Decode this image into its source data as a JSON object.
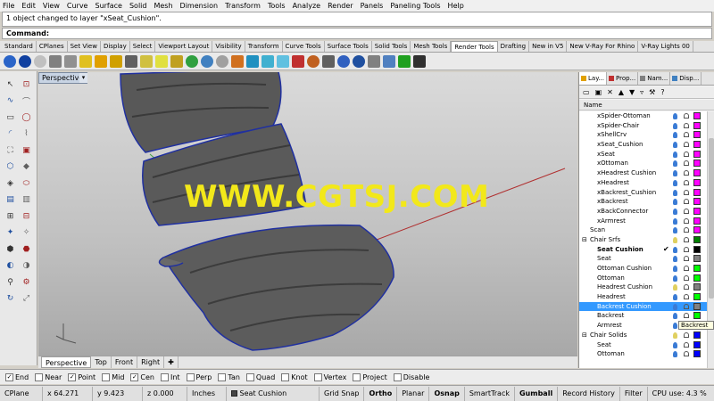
{
  "menu": [
    "File",
    "Edit",
    "View",
    "Curve",
    "Surface",
    "Solid",
    "Mesh",
    "Dimension",
    "Transform",
    "Tools",
    "Analyze",
    "Render",
    "Panels",
    "Paneling Tools",
    "Help"
  ],
  "history_text": "1 object changed to layer \"xSeat_Cushion\".",
  "command_label": "Command:",
  "toolbar_tabs": [
    "Standard",
    "CPlanes",
    "Set View",
    "Display",
    "Select",
    "Viewport Layout",
    "Visibility",
    "Transform",
    "Curve Tools",
    "Surface Tools",
    "Solid Tools",
    "Mesh Tools",
    "Render Tools",
    "Drafting",
    "New in V5",
    "New V-Ray For Rhino",
    "V-Ray Lights 00"
  ],
  "active_toolbar_tab": "Render Tools",
  "viewport": {
    "title": "Perspective",
    "watermark": "WWW.CGTSJ.COM"
  },
  "viewport_tabs": [
    "Perspective",
    "Top",
    "Front",
    "Right"
  ],
  "active_viewport_tab": "Perspective",
  "osnaps": [
    {
      "label": "End",
      "checked": true
    },
    {
      "label": "Near",
      "checked": false
    },
    {
      "label": "Point",
      "checked": true
    },
    {
      "label": "Mid",
      "checked": false
    },
    {
      "label": "Cen",
      "checked": true
    },
    {
      "label": "Int",
      "checked": false
    },
    {
      "label": "Perp",
      "checked": false
    },
    {
      "label": "Tan",
      "checked": false
    },
    {
      "label": "Quad",
      "checked": false
    },
    {
      "label": "Knot",
      "checked": false
    },
    {
      "label": "Vertex",
      "checked": false
    },
    {
      "label": "Project",
      "checked": false
    },
    {
      "label": "Disable",
      "checked": false
    }
  ],
  "status": {
    "cplane": "CPlane",
    "x": "x 64.271",
    "y": "y 9.423",
    "z": "z 0.000",
    "units": "Inches",
    "layer": "Seat Cushion",
    "grid_snap": "Grid Snap",
    "ortho": "Ortho",
    "planar": "Planar",
    "osnap": "Osnap",
    "smarttrack": "SmartTrack",
    "gumball": "Gumball",
    "record_history": "Record History",
    "filter": "Filter",
    "cpu": "CPU use: 4.3 %"
  },
  "panel": {
    "tabs": [
      "Lay...",
      "Prop...",
      "Nam...",
      "Disp..."
    ],
    "active_tab": "Lay...",
    "column_header": "Name",
    "layers": [
      {
        "name": "xSpider-Ottoman",
        "indent": 1,
        "color": "#ff00ff"
      },
      {
        "name": "xSpider-Chair",
        "indent": 1,
        "color": "#ff00ff"
      },
      {
        "name": "xShellCrv",
        "indent": 1,
        "color": "#ff00ff"
      },
      {
        "name": "xSeat_Cushion",
        "indent": 1,
        "color": "#ff00ff"
      },
      {
        "name": "xSeat",
        "indent": 1,
        "color": "#ff00ff"
      },
      {
        "name": "xOttoman",
        "indent": 1,
        "color": "#ff00ff"
      },
      {
        "name": "xHeadrest Cushion",
        "indent": 1,
        "color": "#ff00ff"
      },
      {
        "name": "xHeadrest",
        "indent": 1,
        "color": "#ff00ff"
      },
      {
        "name": "xBackrest_Cushion",
        "indent": 1,
        "color": "#ff00ff"
      },
      {
        "name": "xBackrest",
        "indent": 1,
        "color": "#ff00ff"
      },
      {
        "name": "xBackConnector",
        "indent": 1,
        "color": "#ff00ff"
      },
      {
        "name": "xArmrest",
        "indent": 1,
        "color": "#ff00ff"
      },
      {
        "name": "Scan",
        "indent": 0,
        "color": "#ff00ff"
      },
      {
        "name": "Chair Srfs",
        "indent": -1,
        "color": "#008000",
        "group": true
      },
      {
        "name": "Seat Cushion",
        "indent": 1,
        "color": "#000000",
        "current": true
      },
      {
        "name": "Seat",
        "indent": 1,
        "color": "#808080"
      },
      {
        "name": "Ottoman Cushion",
        "indent": 1,
        "color": "#00ff00"
      },
      {
        "name": "Ottoman",
        "indent": 1,
        "color": "#00ff00"
      },
      {
        "name": "Headrest Cushion",
        "indent": 1,
        "color": "#808080"
      },
      {
        "name": "Headrest",
        "indent": 1,
        "color": "#00ff00"
      },
      {
        "name": "Backrest Cushion",
        "indent": 1,
        "color": "#808080",
        "selected": true
      },
      {
        "name": "Backrest",
        "indent": 1,
        "color": "#00ff00"
      },
      {
        "name": "Armrest",
        "indent": 1,
        "color": "#00ff00"
      },
      {
        "name": "Chair Solids",
        "indent": -1,
        "color": "#0000ff",
        "group": true
      },
      {
        "name": "Seat",
        "indent": 1,
        "color": "#0000ff"
      },
      {
        "name": "Ottoman",
        "indent": 1,
        "color": "#0000ff"
      }
    ],
    "tooltip": "Backrest Cu"
  }
}
